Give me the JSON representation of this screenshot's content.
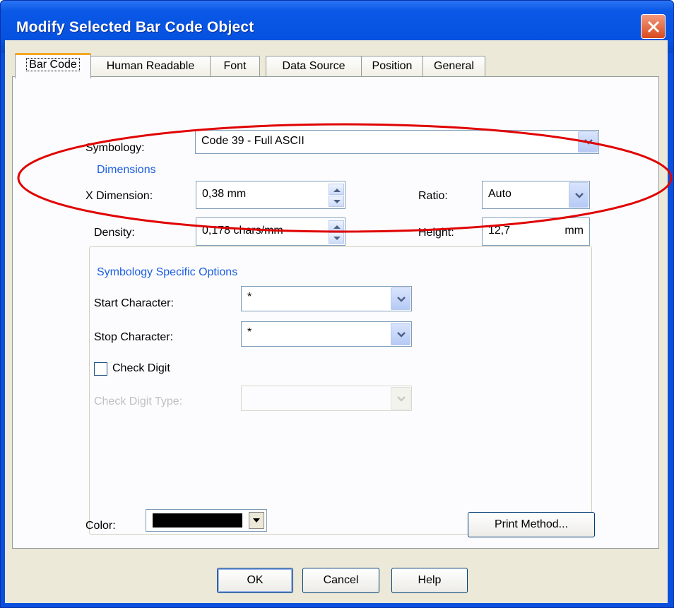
{
  "window": {
    "title": "Modify Selected Bar Code Object"
  },
  "tabs": [
    {
      "label": "Bar Code",
      "active": true
    },
    {
      "label": "Human Readable"
    },
    {
      "label": "Font"
    },
    {
      "label": "Data Source"
    },
    {
      "label": "Position"
    },
    {
      "label": "General"
    }
  ],
  "symbology": {
    "label": "Symbology:",
    "value": "Code 39 - Full ASCII"
  },
  "dimensions": {
    "group_label": "Dimensions",
    "x_dimension": {
      "label": "X Dimension:",
      "value": "0,38",
      "unit": "mm"
    },
    "density": {
      "label": "Density:",
      "value": "0,178",
      "unit": "chars/mm"
    },
    "ratio": {
      "label": "Ratio:",
      "value": "Auto"
    },
    "height": {
      "label": "Height:",
      "value": "12,7",
      "unit": "mm"
    }
  },
  "options": {
    "group_label": "Symbology Specific Options",
    "start_character": {
      "label": "Start Character:",
      "value": "*"
    },
    "stop_character": {
      "label": "Stop Character:",
      "value": "*"
    },
    "check_digit": {
      "label": "Check Digit",
      "checked": false
    },
    "check_digit_type": {
      "label": "Check Digit Type:",
      "value": ""
    }
  },
  "color": {
    "label": "Color:",
    "value": "#000000"
  },
  "buttons": {
    "print_method": "Print Method...",
    "ok": "OK",
    "cancel": "Cancel",
    "help": "Help"
  },
  "annotation": {
    "color": "#e00000"
  }
}
